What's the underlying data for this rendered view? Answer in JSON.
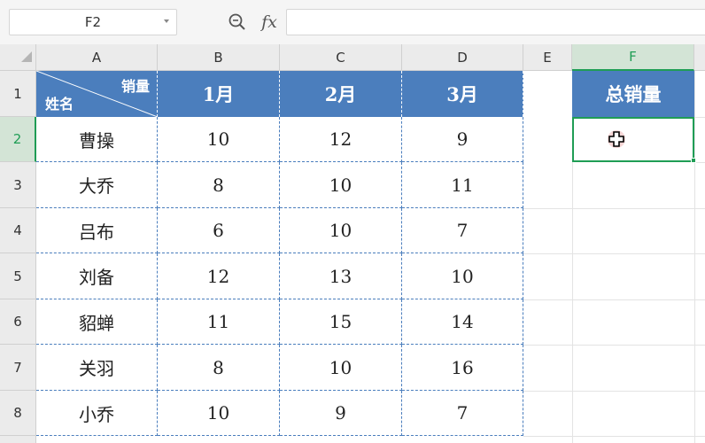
{
  "formula_bar": {
    "name_box": "F2",
    "fx_label": "fx",
    "formula": ""
  },
  "columns": [
    "A",
    "B",
    "C",
    "D",
    "E",
    "F"
  ],
  "selected_column": "F",
  "rows": [
    "1",
    "2",
    "3",
    "4",
    "5",
    "6",
    "7",
    "8"
  ],
  "selected_row": "2",
  "table": {
    "diag_header_top": "销量",
    "diag_header_bottom": "姓名",
    "month_headers": [
      "1月",
      "2月",
      "3月"
    ],
    "body": [
      {
        "name": "曹操",
        "values": [
          "10",
          "12",
          "9"
        ]
      },
      {
        "name": "大乔",
        "values": [
          "8",
          "10",
          "11"
        ]
      },
      {
        "name": "吕布",
        "values": [
          "6",
          "10",
          "7"
        ]
      },
      {
        "name": "刘备",
        "values": [
          "12",
          "13",
          "10"
        ]
      },
      {
        "name": "貂蝉",
        "values": [
          "11",
          "15",
          "14"
        ]
      },
      {
        "name": "关羽",
        "values": [
          "8",
          "10",
          "16"
        ]
      },
      {
        "name": "小乔",
        "values": [
          "10",
          "9",
          "7"
        ]
      }
    ]
  },
  "total_header": "总销量",
  "active_cell_value": "",
  "colors": {
    "header_fill": "#4b7ebd",
    "selection_green": "#1f9d55"
  }
}
